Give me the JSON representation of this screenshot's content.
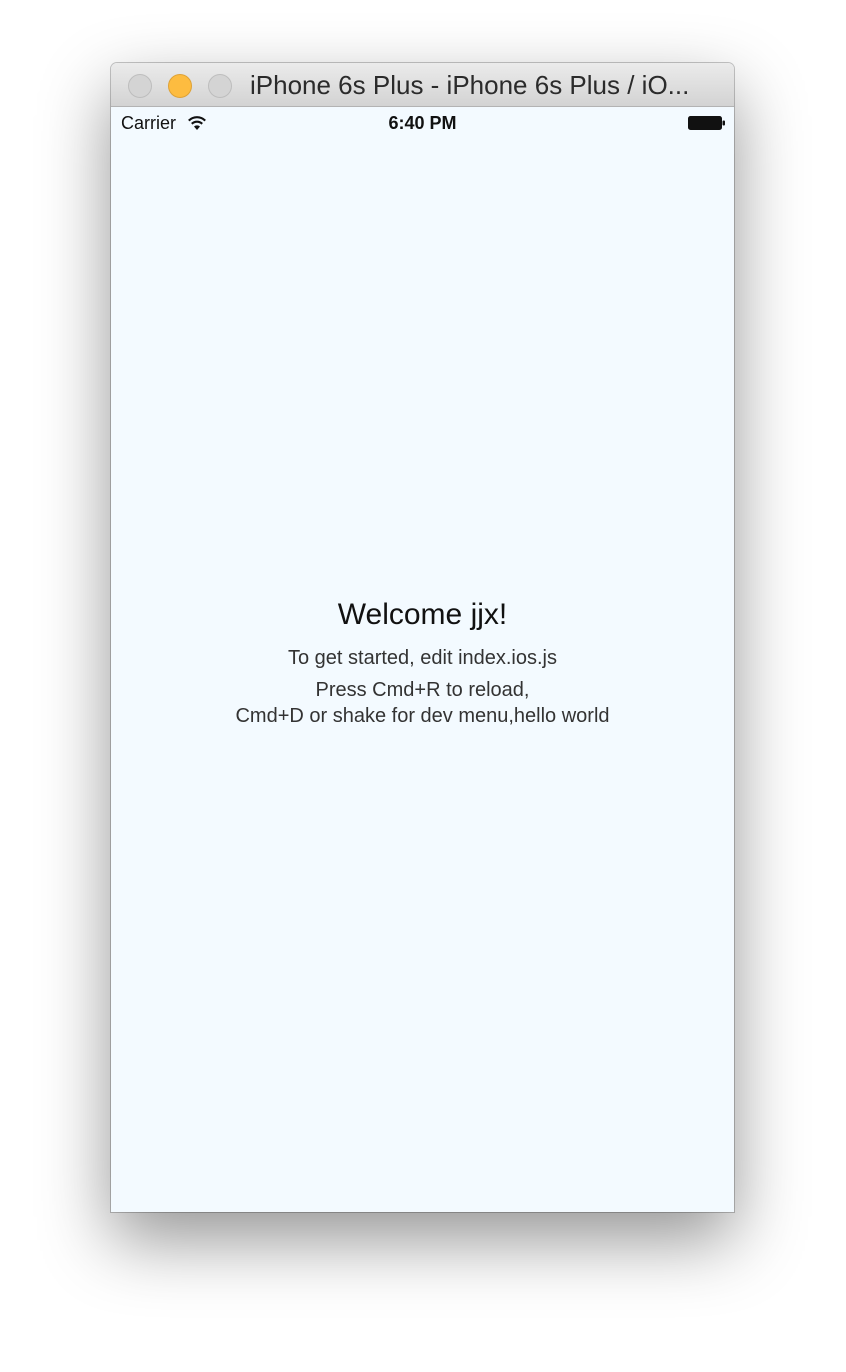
{
  "window": {
    "title": "iPhone 6s Plus - iPhone 6s Plus / iO..."
  },
  "statusbar": {
    "carrier": "Carrier",
    "time": "6:40 PM",
    "wifi_icon": "wifi-icon",
    "battery_icon": "battery-icon"
  },
  "app": {
    "welcome": "Welcome jjx!",
    "instructions_1": "To get started, edit index.ios.js",
    "instructions_2_line1": "Press Cmd+R to reload,",
    "instructions_2_line2": "Cmd+D or shake for dev menu,hello world"
  },
  "colors": {
    "background": "#f3faff",
    "minimize_button": "#fdbc40"
  }
}
